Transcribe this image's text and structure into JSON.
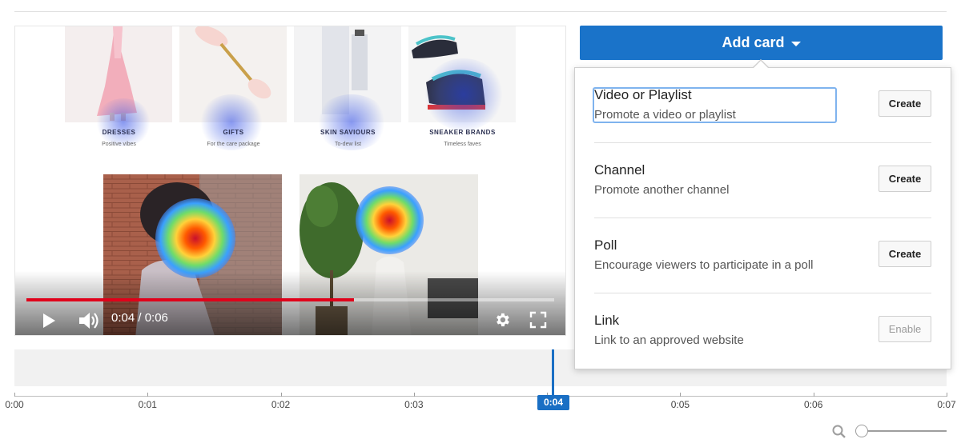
{
  "player": {
    "time_display": "0:04 / 0:06",
    "progress_fraction": 0.62,
    "categories": [
      {
        "title": "DRESSES",
        "subtitle": "Positive vibes"
      },
      {
        "title": "GIFTS",
        "subtitle": "For the care package"
      },
      {
        "title": "SKIN SAVIOURS",
        "subtitle": "To-dew list"
      },
      {
        "title": "SNEAKER BRANDS",
        "subtitle": "Timeless faves"
      }
    ],
    "colors": {
      "progress": "#e0001a"
    }
  },
  "add_card": {
    "label": "Add card",
    "color": "#1a73c9",
    "items": [
      {
        "title": "Video or Playlist",
        "description": "Promote a video or playlist",
        "button": "Create",
        "enabled": true
      },
      {
        "title": "Channel",
        "description": "Promote another channel",
        "button": "Create",
        "enabled": true
      },
      {
        "title": "Poll",
        "description": "Encourage viewers to participate in a poll",
        "button": "Create",
        "enabled": true
      },
      {
        "title": "Link",
        "description": "Link to an approved website",
        "button": "Enable",
        "enabled": false
      }
    ]
  },
  "timeline": {
    "ticks": [
      "0:00",
      "0:01",
      "0:02",
      "0:03",
      "0:04",
      "0:05",
      "0:06",
      "0:07"
    ],
    "playhead_label": "0:04",
    "playhead_color": "#1a6fc4"
  },
  "icons": {
    "play": "play-icon",
    "volume": "volume-icon",
    "settings": "gear-icon",
    "fullscreen": "fullscreen-icon",
    "zoom": "search-icon"
  }
}
